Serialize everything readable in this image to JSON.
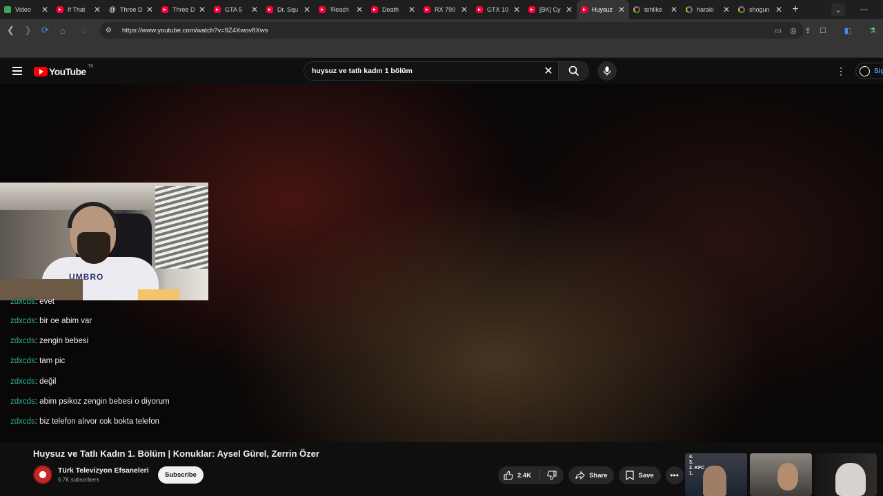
{
  "browser": {
    "tabs": [
      {
        "title": "Video",
        "favicon": "video-icon"
      },
      {
        "title": "If That",
        "favicon": "youtube-icon"
      },
      {
        "title": "Three D",
        "favicon": "threads-icon"
      },
      {
        "title": "Three D",
        "favicon": "youtube-icon"
      },
      {
        "title": "GTA 5",
        "favicon": "youtube-icon"
      },
      {
        "title": "Dr. Squ",
        "favicon": "youtube-icon"
      },
      {
        "title": "'Reach",
        "favicon": "youtube-icon"
      },
      {
        "title": "Death",
        "favicon": "youtube-icon"
      },
      {
        "title": "RX 790",
        "favicon": "youtube-icon"
      },
      {
        "title": "GTX 10",
        "favicon": "youtube-icon"
      },
      {
        "title": "[BK] Cy",
        "favicon": "youtube-icon"
      },
      {
        "title": "Huysuz",
        "favicon": "youtube-icon",
        "active": true
      },
      {
        "title": "tehlike",
        "favicon": "google-icon"
      },
      {
        "title": "haraki",
        "favicon": "google-icon"
      },
      {
        "title": "shogun",
        "favicon": "google-icon"
      }
    ],
    "new_tab": "+",
    "url": "https://www.youtube.com/watch?v=9Z4Xwov8Xws"
  },
  "youtube": {
    "logo_text": "YouTube",
    "country_code": "TR",
    "search_query": "huysuz ve tatlı kadın 1 bölüm",
    "signin_label": "Sig"
  },
  "chat": [
    {
      "user": "zdxcds",
      "message": ": evet"
    },
    {
      "user": "zdxcds",
      "message": ": bir oe abim var"
    },
    {
      "user": "zdxcds",
      "message": ": zengin bebesi"
    },
    {
      "user": "zdxcds",
      "message": ": tam pic"
    },
    {
      "user": "zdxcds",
      "message": ": değil"
    },
    {
      "user": "zdxcds",
      "message": ": abim psikoz zengin bebesi o diyorum"
    },
    {
      "user": "zdxcds",
      "message": ": biz telefon alıvor cok bokta telefon"
    }
  ],
  "webcam": {
    "shirt_text": "UMBRO"
  },
  "video": {
    "title": "Huysuz ve Tatlı Kadın 1. Bölüm | Konuklar: Aysel Gürel, Zerrin Özer",
    "channel": "Türk Televizyon Efsaneleri",
    "subscribers": "6.7K subscribers",
    "subscribe_label": "Subscribe",
    "likes": "2.4K",
    "share_label": "Share",
    "save_label": "Save"
  },
  "recommended": [
    {
      "overlay_text": "4.\n3.\n2. KFC\n1."
    },
    {
      "overlay_text": ""
    },
    {
      "overlay_text": ""
    }
  ],
  "colors": {
    "chat_username": "#2fb59b",
    "youtube_red": "#ff0000",
    "signin_blue": "#3ea6ff"
  }
}
